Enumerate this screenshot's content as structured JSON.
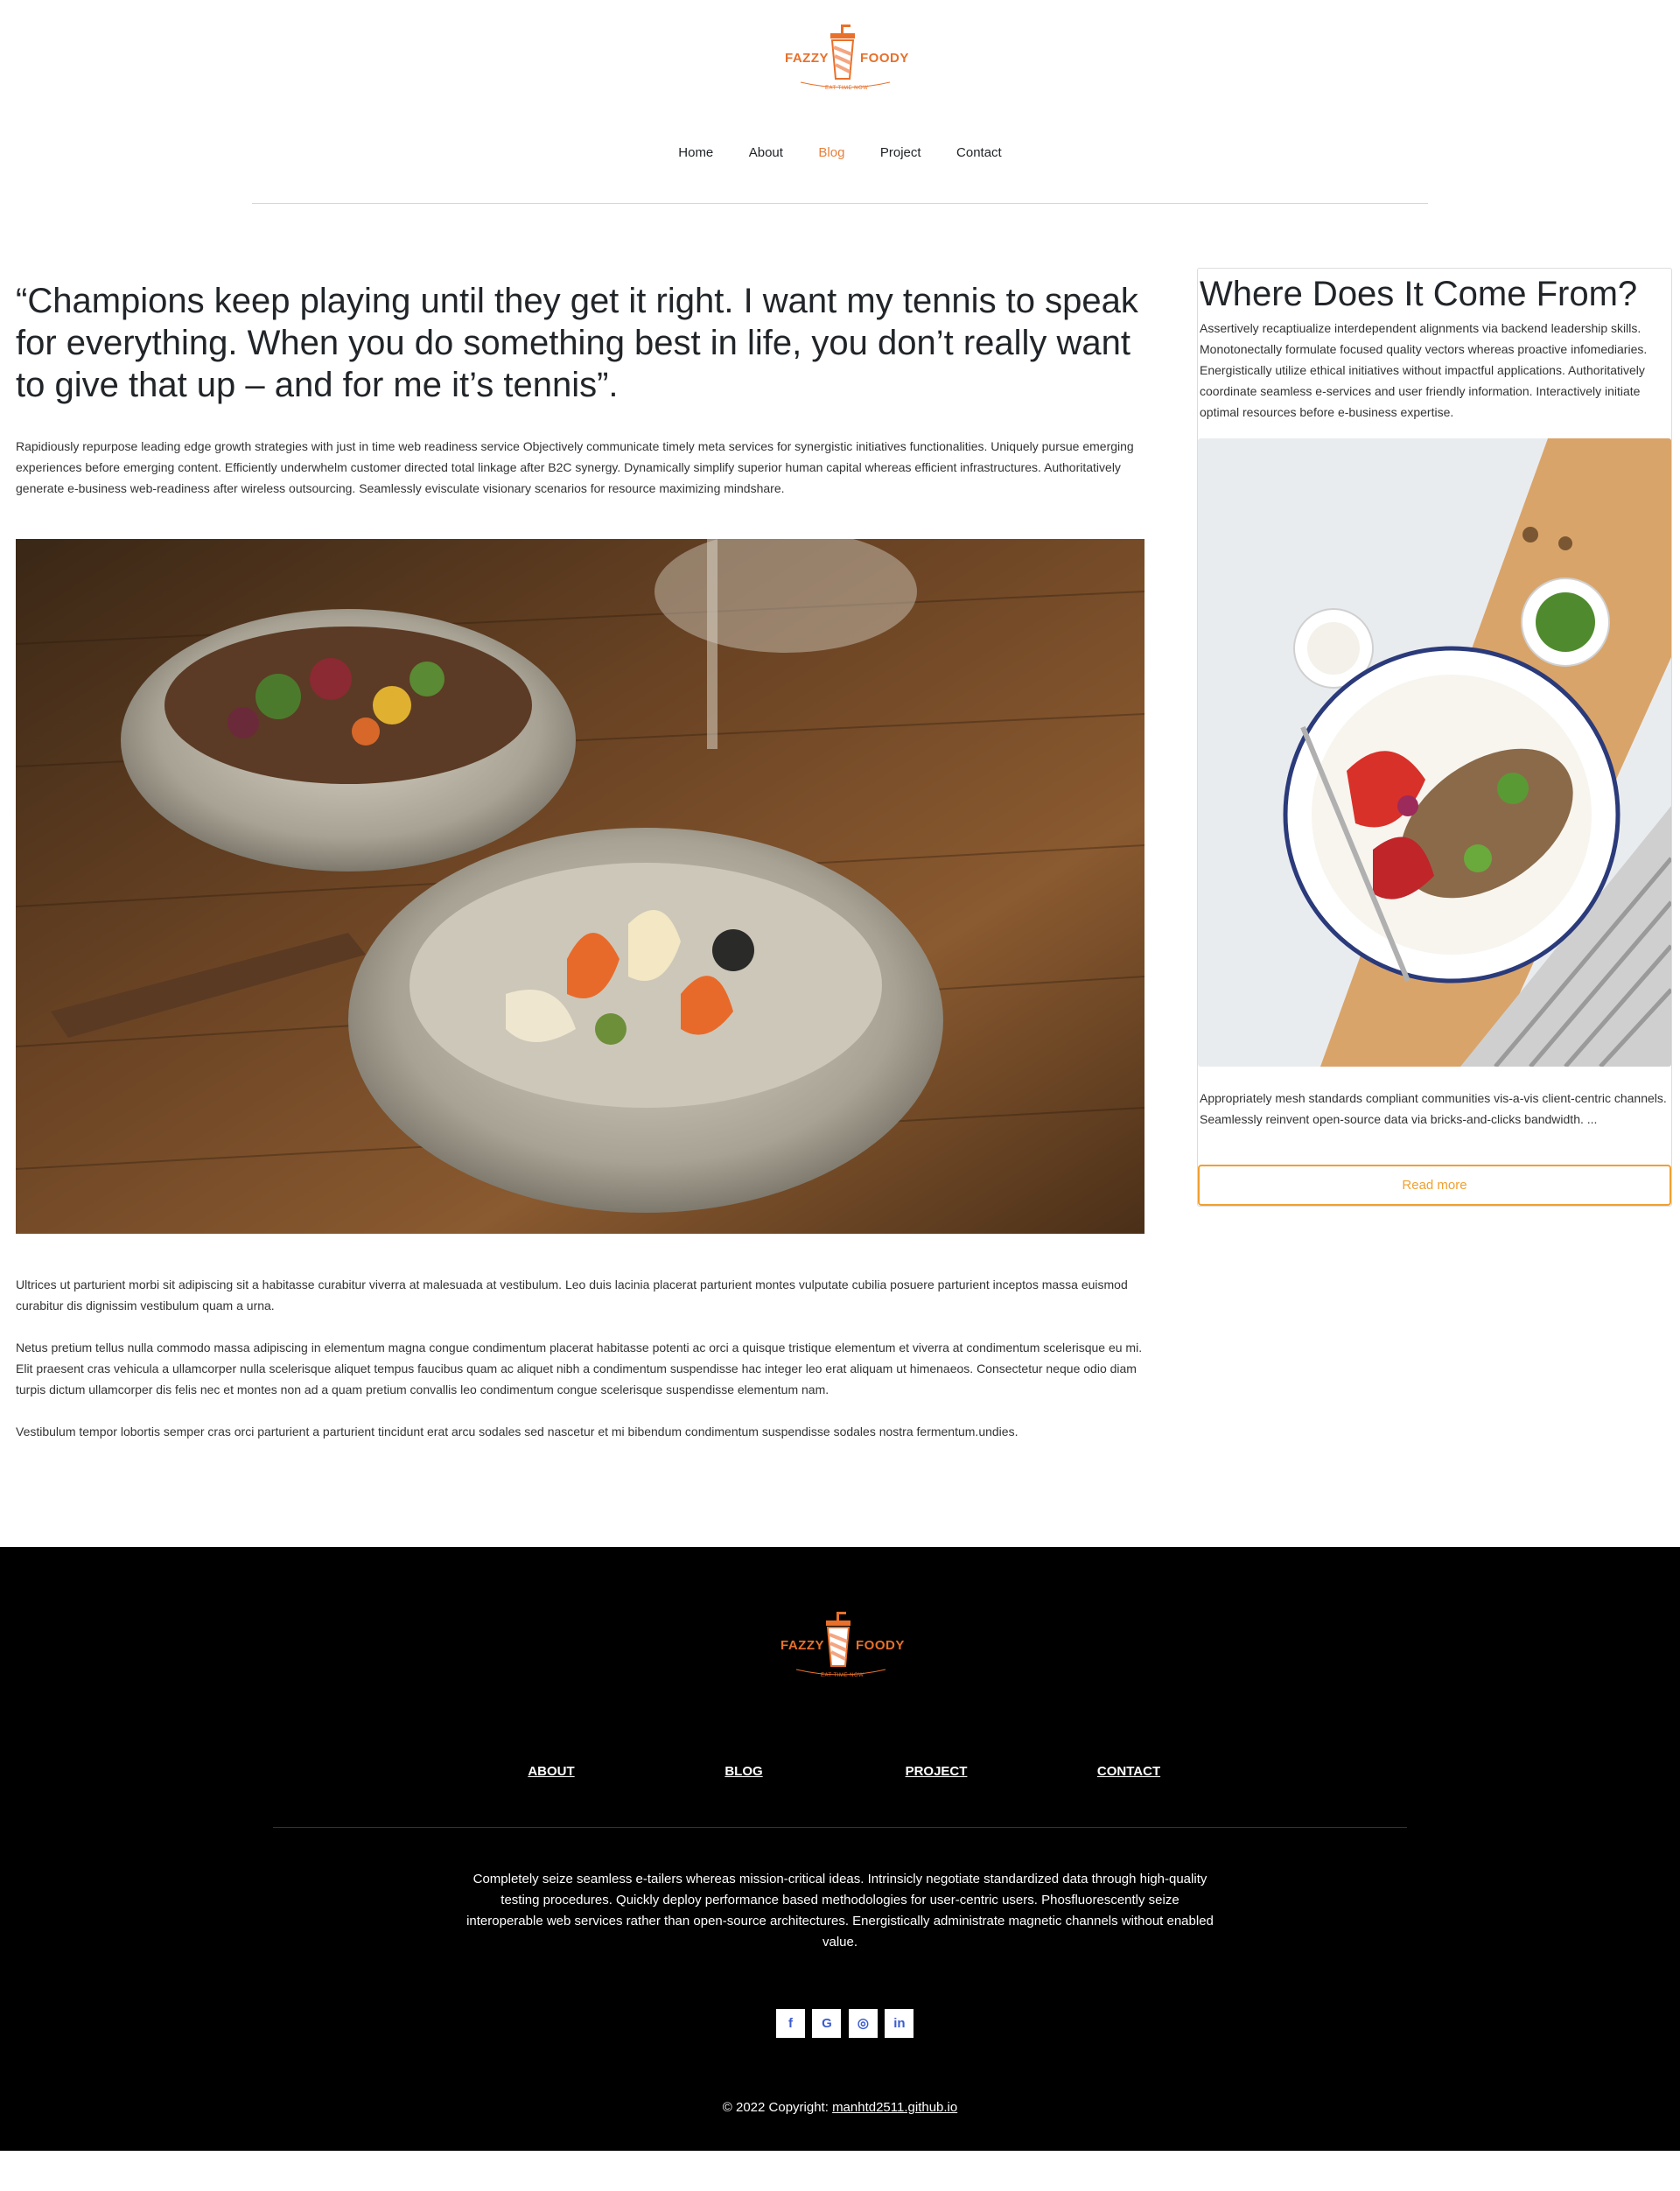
{
  "brand": {
    "left_word": "FAZZY",
    "right_word": "FOODY",
    "tagline": "EAT TIME NOW",
    "accent_color": "#e8702a"
  },
  "nav": {
    "items": [
      {
        "label": "Home",
        "active": false
      },
      {
        "label": "About",
        "active": false
      },
      {
        "label": "Blog",
        "active": true
      },
      {
        "label": "Project",
        "active": false
      },
      {
        "label": "Contact",
        "active": false
      }
    ]
  },
  "article": {
    "quote": "“Champions keep playing until they get it right. I want my tennis to speak for everything. When you do something best in life, you don’t really want to give that up – and for me it’s tennis”.",
    "intro": "Rapidiously repurpose leading edge growth strategies with just in time web readiness service Objectively communicate timely meta services for synergistic initiatives functionalities. Uniquely pursue emerging experiences before emerging content. Efficiently underwhelm customer directed total linkage after B2C synergy. Dynamically simplify superior human capital whereas efficient infrastructures. Authoritatively generate e-business web-readiness after wireless outsourcing. Seamlessly evisculate visionary scenarios for resource maximizing mindshare.",
    "paragraphs": [
      "Ultrices ut parturient morbi sit adipiscing sit a habitasse curabitur viverra at malesuada at vestibulum. Leo duis lacinia placerat parturient montes vulputate cubilia posuere parturient inceptos massa euismod curabitur dis dignissim vestibulum quam a urna.",
      "Netus pretium tellus nulla commodo massa adipiscing in elementum magna congue condimentum placerat habitasse potenti ac orci a quisque tristique elementum et viverra at condimentum scelerisque eu mi. Elit praesent cras vehicula a ullamcorper nulla scelerisque aliquet tempus faucibus quam ac aliquet nibh a condimentum suspendisse hac integer leo erat aliquam ut himenaeos. Consectetur neque odio diam turpis dictum ullamcorper dis felis nec et montes non ad a quam pretium convallis leo condimentum congue scelerisque suspendisse elementum nam.",
      "Vestibulum tempor lobortis semper cras orci parturient a parturient tincidunt erat arcu sodales sed nascetur et mi bibendum condimentum suspendisse sodales nostra fermentum.undies."
    ]
  },
  "sidebar": {
    "title": "Where Does It Come From?",
    "description": "Assertively recaptiualize interdependent alignments via backend leadership skills. Monotonectally formulate focused quality vectors whereas proactive infomediaries. Energistically utilize ethical initiatives without impactful applications. Authoritatively coordinate seamless e-services and user friendly information. Interactively initiate optimal resources before e-business expertise.",
    "excerpt": "Appropriately mesh standards compliant communities vis-a-vis client-centric channels. Seamlessly reinvent open-source data via bricks-and-clicks bandwidth. ...",
    "read_more": "Read more",
    "button_color": "#f0a030"
  },
  "footer": {
    "links": [
      "ABOUT",
      "BLOG",
      "PROJECT",
      "CONTACT"
    ],
    "text": "Completely seize seamless e-tailers whereas mission-critical ideas. Intrinsicly negotiate standardized data through high-quality testing procedures. Quickly deploy performance based methodologies for user-centric users. Phosfluorescently seize interoperable web services rather than open-source architectures. Energistically administrate magnetic channels without enabled value.",
    "social": [
      {
        "icon": "facebook-icon",
        "glyph": "f"
      },
      {
        "icon": "google-icon",
        "glyph": "G"
      },
      {
        "icon": "instagram-icon",
        "glyph": "◎"
      },
      {
        "icon": "linkedin-icon",
        "glyph": "in"
      }
    ],
    "copyright_prefix": "© 2022 Copyright: ",
    "copyright_link": "manhtd2511.github.io"
  }
}
